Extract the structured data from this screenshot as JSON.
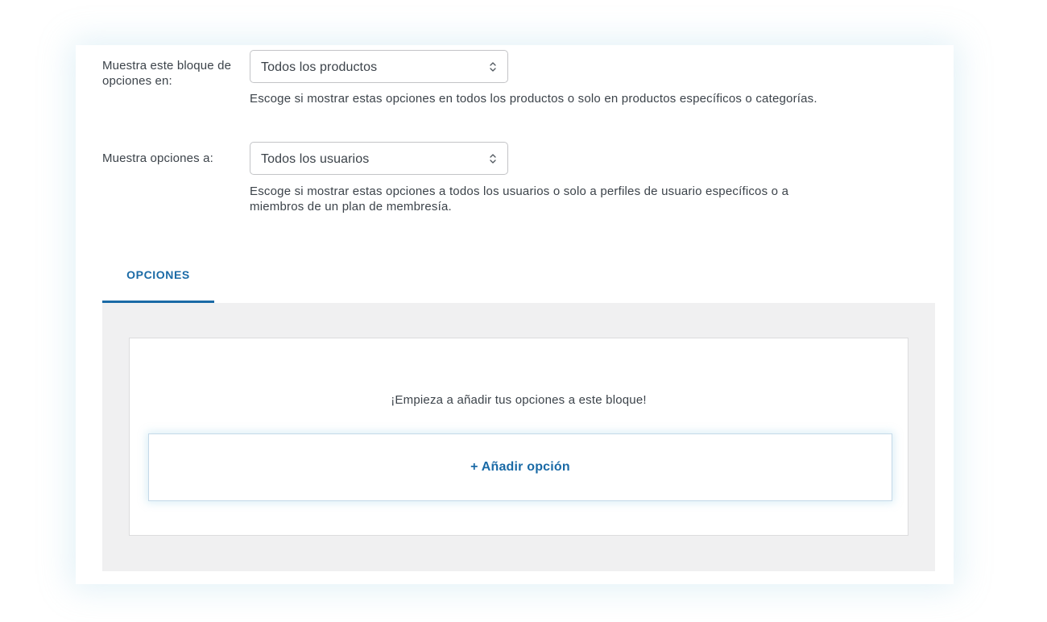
{
  "display_block": {
    "label": "Muestra este bloque de opciones en:",
    "select_value": "Todos los productos",
    "help": "Escoge si mostrar estas opciones en todos los productos o solo en productos específicos o categorías."
  },
  "display_options": {
    "label": "Muestra opciones a:",
    "select_value": "Todos los usuarios",
    "help": "Escoge si mostrar estas opciones a todos los usuarios o solo a perfiles de usuario específicos o a miembros de un plan de membresía."
  },
  "tabs": [
    {
      "label": "OPCIONES",
      "active": true
    }
  ],
  "options_panel": {
    "empty_message": "¡Empieza a añadir tus opciones a este bloque!",
    "add_button_label": "+ Añadir opción"
  },
  "icons": {
    "select_arrow": "chevron-up-down-icon"
  },
  "colors": {
    "accent": "#1a6aa6",
    "text": "#3c434a",
    "panel_bg": "#f0f0f1",
    "border": "#c3c4c7"
  }
}
